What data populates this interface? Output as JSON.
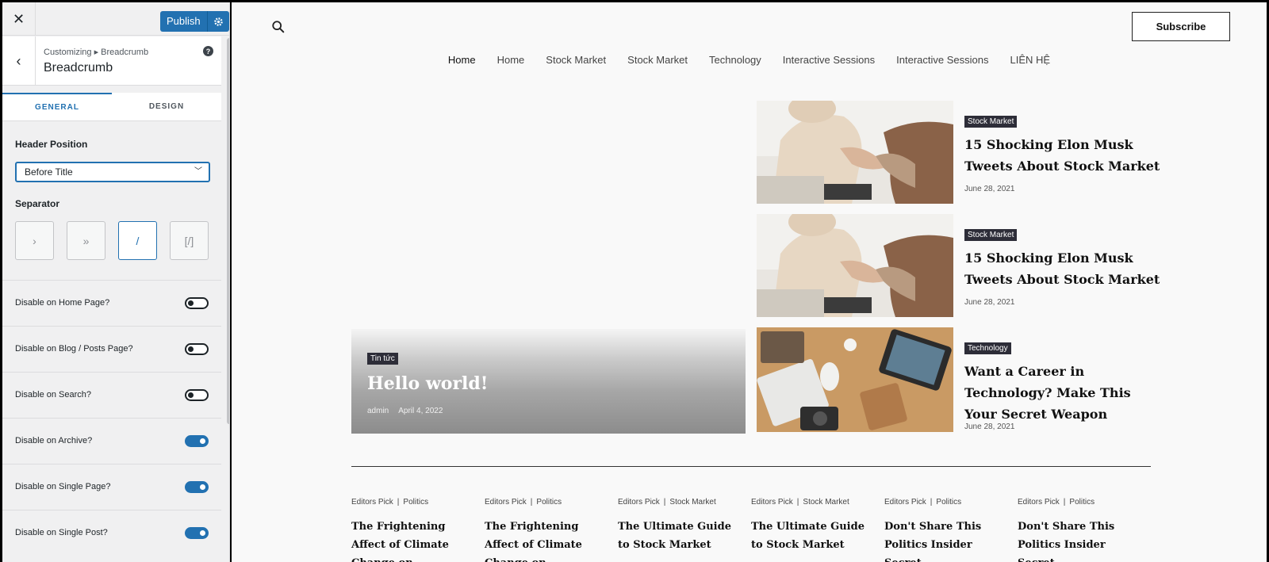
{
  "customizer": {
    "close_glyph": "✕",
    "publish_label": "Publish",
    "back_glyph": "‹",
    "crumb_small": "Customizing ▸ Breadcrumb",
    "section_title": "Breadcrumb",
    "help_glyph": "?",
    "tabs": [
      {
        "label": "GENERAL",
        "active": true
      },
      {
        "label": "DESIGN",
        "active": false
      }
    ],
    "header_position_label": "Header Position",
    "header_position_value": "Before Title",
    "separator_label": "Separator",
    "separators": [
      {
        "glyph": "›",
        "active": false
      },
      {
        "glyph": "»",
        "active": false
      },
      {
        "glyph": "/",
        "active": true
      },
      {
        "glyph": "[/]",
        "active": false
      }
    ],
    "toggles": [
      {
        "label": "Disable on Home Page?",
        "on": false
      },
      {
        "label": "Disable on Blog / Posts Page?",
        "on": false
      },
      {
        "label": "Disable on Search?",
        "on": false
      },
      {
        "label": "Disable on Archive?",
        "on": true
      },
      {
        "label": "Disable on Single Page?",
        "on": true
      },
      {
        "label": "Disable on Single Post?",
        "on": true
      }
    ]
  },
  "site": {
    "subscribe_label": "Subscribe",
    "nav": [
      "Home",
      "Home",
      "Stock Market",
      "Stock Market",
      "Technology",
      "Interactive Sessions",
      "Interactive Sessions",
      "LIÊN HỆ"
    ],
    "hero": {
      "category": "Tin tức",
      "title": "Hello world!",
      "author": "admin",
      "date": "April 4, 2022"
    },
    "side_posts": [
      {
        "category": "Stock Market",
        "title": "15 Shocking Elon Musk Tweets About Stock Market",
        "date": "June 28, 2021",
        "image": "handshake"
      },
      {
        "category": "Stock Market",
        "title": "15 Shocking Elon Musk Tweets About Stock Market",
        "date": "June 28, 2021",
        "image": "handshake"
      },
      {
        "category": "Technology",
        "title": "Want a Career in Technology? Make This Your Secret Weapon",
        "date": "June 28, 2021",
        "image": "desk"
      }
    ],
    "bottom_posts": [
      {
        "cat1": "Editors Pick",
        "cat2": "Politics",
        "title": "The Frightening Affect of Climate Change on"
      },
      {
        "cat1": "Editors Pick",
        "cat2": "Politics",
        "title": "The Frightening Affect of Climate Change on"
      },
      {
        "cat1": "Editors Pick",
        "cat2": "Stock Market",
        "title": "The Ultimate Guide to Stock Market"
      },
      {
        "cat1": "Editors Pick",
        "cat2": "Stock Market",
        "title": "The Ultimate Guide to Stock Market"
      },
      {
        "cat1": "Editors Pick",
        "cat2": "Politics",
        "title": "Don't Share This Politics Insider Secret"
      },
      {
        "cat1": "Editors Pick",
        "cat2": "Politics",
        "title": "Don't Share This Politics Insider Secret"
      }
    ],
    "colors": {
      "accent": "#2271b1",
      "badge": "#2d2d38"
    }
  }
}
